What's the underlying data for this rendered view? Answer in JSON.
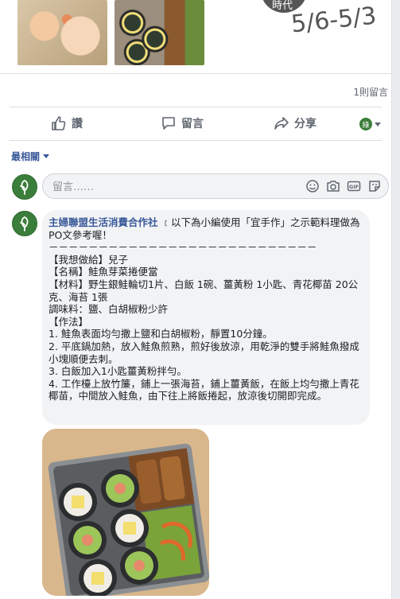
{
  "stamp": {
    "label": "時代",
    "date": "5/6-5/3"
  },
  "stats": {
    "comments": "1則留言"
  },
  "actions": {
    "like": "讚",
    "comment": "留言",
    "share": "分享"
  },
  "sort": {
    "label": "最相關"
  },
  "composer": {
    "placeholder": "留言……"
  },
  "comment": {
    "author": "主婦聯盟生活消費合作社",
    "body": " ﹝以下為小編使用「宜手作」之示範料理做為PO文參考喔！\n－－－－－－－－－－－－－－－－－－－－－－－－－－－\n【我想做給】兒子\n【名稱】鮭魚芽菜捲便當\n【材料】野生銀鮭輪切1片、白飯 1碗、薑黃粉 1小匙、青花椰苗 20公克、海苔 1張\n調味料：鹽、白胡椒粉少許\n【作法】\n1. 鮭魚表面均勻撒上鹽和白胡椒粉，靜置10分鐘。\n2. 平底鍋加熱，放入鮭魚煎熟，煎好後放涼，用乾淨的雙手將鮭魚撥成小塊順便去刺。\n3. 白飯加入1小匙薑黃粉拌勻。\n4. 工作檯上放竹簾，鋪上一張海苔，鋪上薑黃飯，在飯上均勻撒上青花椰苗，中間放入鮭魚，由下往上將飯捲起，放涼後切開即完成。"
  },
  "icons": {
    "like": "thumbs-up-icon",
    "comment": "speech-bubble-icon",
    "share": "share-arrow-icon",
    "emoji": "smiley-icon",
    "camera": "camera-icon",
    "gif": "gif-icon",
    "sticker": "sticker-icon"
  },
  "colors": {
    "link": "#385898",
    "brand_green": "#3b7d3b",
    "bubble": "#f2f3f5"
  }
}
